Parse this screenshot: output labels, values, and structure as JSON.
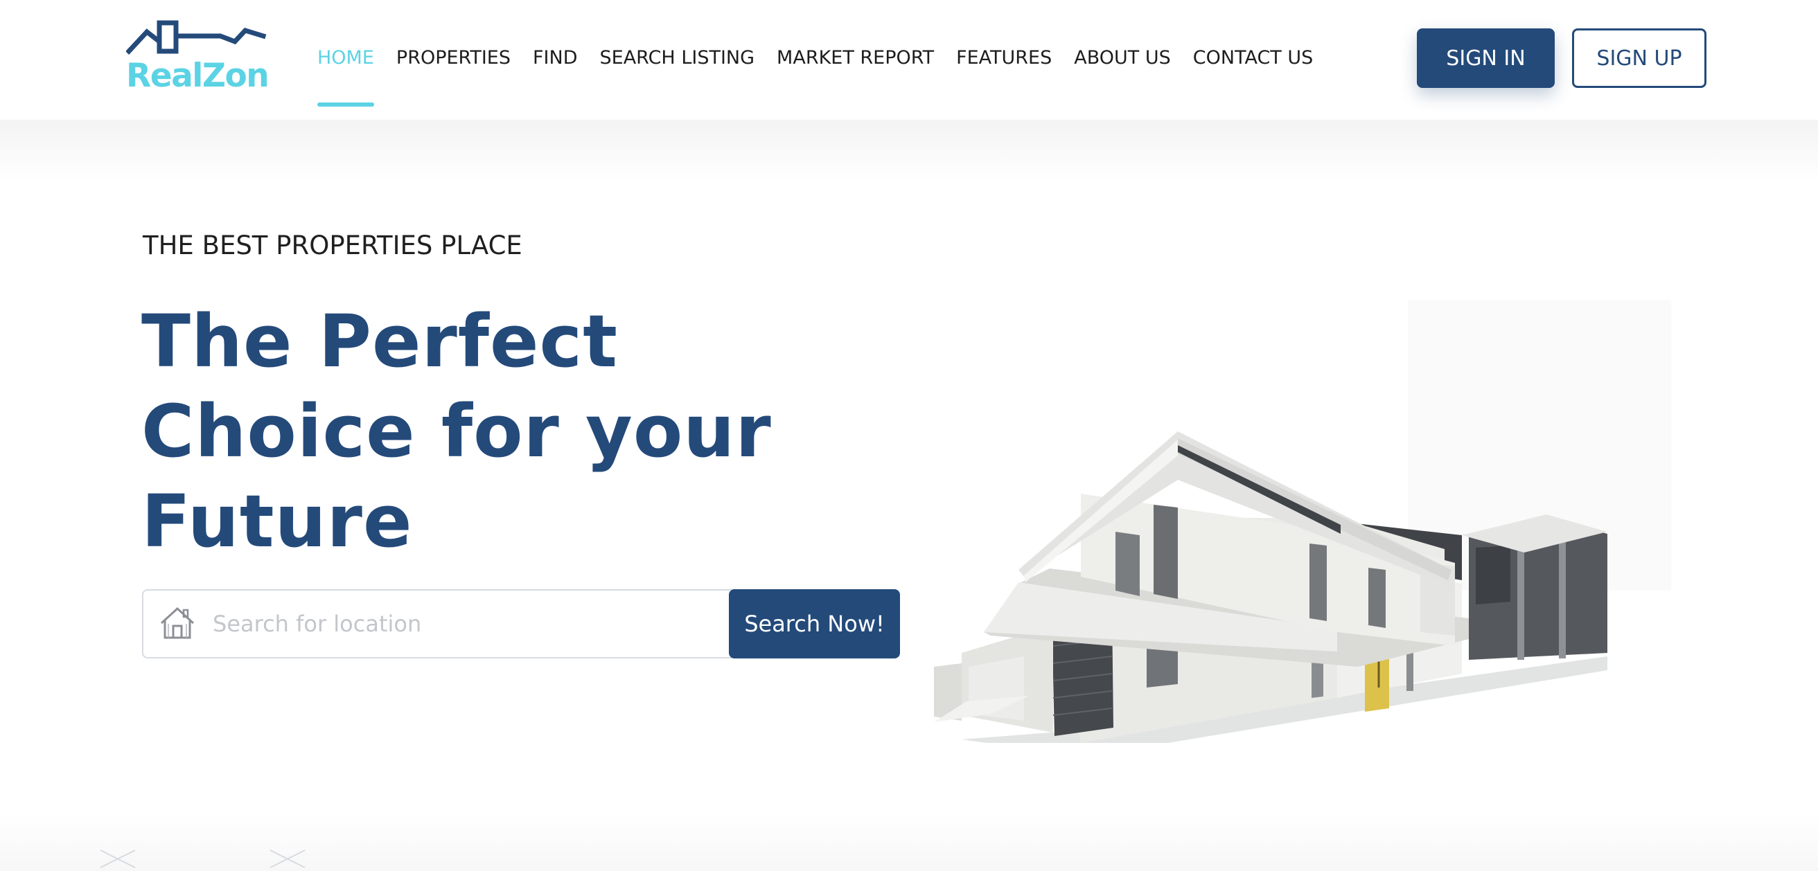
{
  "brand": {
    "name": "RealZon",
    "primary_color": "#244a7a",
    "accent_color": "#5bd3e4"
  },
  "nav": {
    "items": [
      {
        "label": "HOME",
        "active": true
      },
      {
        "label": "PROPERTIES",
        "active": false
      },
      {
        "label": "FIND",
        "active": false
      },
      {
        "label": "SEARCH LISTING",
        "active": false
      },
      {
        "label": "MARKET REPORT",
        "active": false
      },
      {
        "label": "FEATURES",
        "active": false
      },
      {
        "label": "ABOUT US",
        "active": false
      },
      {
        "label": "CONTACT US",
        "active": false
      }
    ]
  },
  "auth": {
    "signin_label": "SIGN IN",
    "signup_label": "SIGN UP"
  },
  "hero": {
    "eyebrow": "THE BEST PROPERTIES PLACE",
    "headline": "The Perfect Choice for your Future",
    "search_placeholder": "Search for location",
    "search_value": "",
    "search_button": "Search Now!",
    "search_icon": "house-icon",
    "illustration": "modern-house-illustration"
  }
}
